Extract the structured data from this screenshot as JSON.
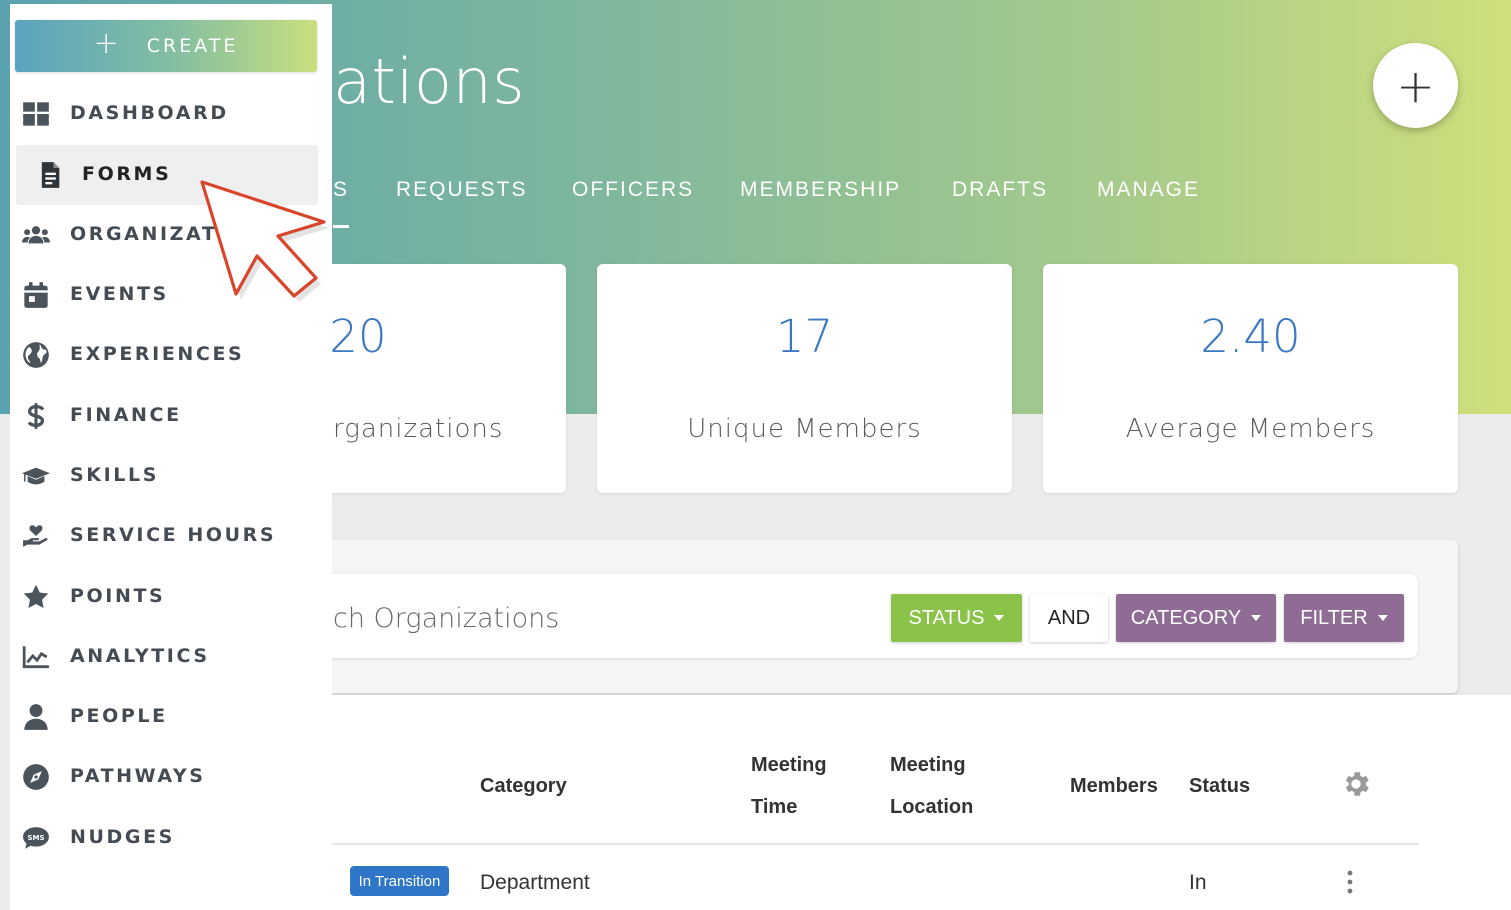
{
  "page": {
    "title_visible": "ations",
    "fab_label": "+"
  },
  "tabs": [
    {
      "label": "S",
      "active": true
    },
    {
      "label": "REQUESTS"
    },
    {
      "label": "OFFICERS"
    },
    {
      "label": "MEMBERSHIP"
    },
    {
      "label": "DRAFTS"
    },
    {
      "label": "MANAGE"
    }
  ],
  "stats": [
    {
      "value": "20",
      "label": "rganizations"
    },
    {
      "value": "17",
      "label": "Unique Members"
    },
    {
      "value": "2.40",
      "label": "Average Members"
    }
  ],
  "search": {
    "placeholder": "ch Organizations",
    "buttons": {
      "status": "STATUS",
      "and": "AND",
      "category": "CATEGORY",
      "filter": "FILTER"
    },
    "colors": {
      "status": "#8bc34a",
      "category": "#8e6c94",
      "filter": "#8e6c94"
    }
  },
  "table": {
    "headers": {
      "category": "Category",
      "meeting_time_1": "Meeting",
      "meeting_time_2": "Time",
      "meeting_location_1": "Meeting",
      "meeting_location_2": "Location",
      "members": "Members",
      "status": "Status"
    },
    "rows": [
      {
        "badge": "In Transition",
        "category": "Department",
        "status": "In"
      }
    ],
    "badge_color": "#2f76c9"
  },
  "sidebar": {
    "create_label": "CREATE",
    "create_icon": "+",
    "items": [
      {
        "label": "DASHBOARD",
        "icon": "dashboard-icon"
      },
      {
        "label": "FORMS",
        "icon": "document-icon",
        "active": true
      },
      {
        "label": "ORGANIZATIO",
        "icon": "users-icon"
      },
      {
        "label": "EVENTS",
        "icon": "calendar-icon"
      },
      {
        "label": "EXPERIENCES",
        "icon": "globe-icon"
      },
      {
        "label": "FINANCE",
        "icon": "dollar-icon"
      },
      {
        "label": "SKILLS",
        "icon": "graduation-cap-icon"
      },
      {
        "label": "SERVICE HOURS",
        "icon": "hand-heart-icon"
      },
      {
        "label": "POINTS",
        "icon": "star-icon"
      },
      {
        "label": "ANALYTICS",
        "icon": "chart-line-icon"
      },
      {
        "label": "PEOPLE",
        "icon": "person-icon"
      },
      {
        "label": "PATHWAYS",
        "icon": "compass-icon"
      },
      {
        "label": "NUDGES",
        "icon": "sms-icon"
      }
    ]
  },
  "theme": {
    "accent": "#3a78c2",
    "hero_gradient_start": "#5aa3ae",
    "hero_gradient_end": "#cfe07c",
    "cursor_outline": "#d9452b"
  }
}
